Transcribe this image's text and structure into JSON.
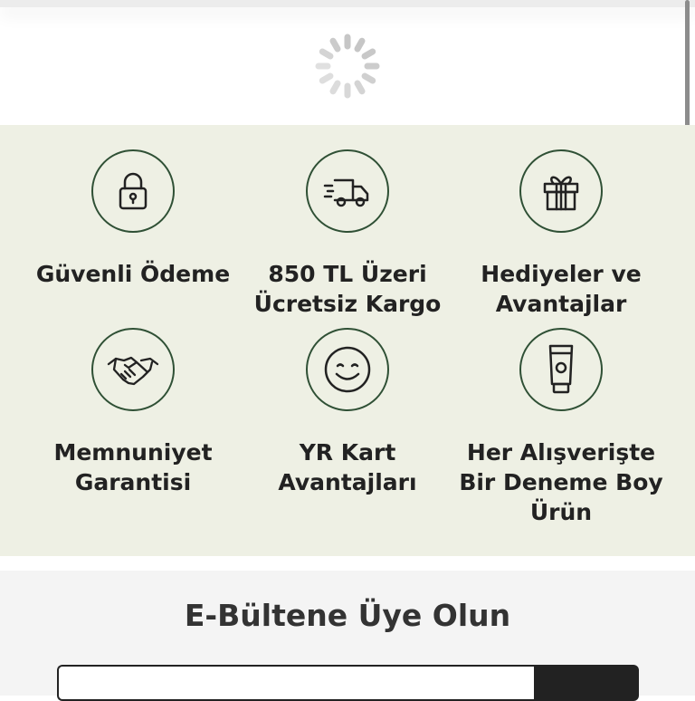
{
  "loading": {
    "icon": "spinner-icon"
  },
  "features": [
    {
      "label": "Güvenli Ödeme",
      "icon": "lock-icon"
    },
    {
      "label": "850 TL Üzeri Ücretsiz Kargo",
      "icon": "delivery-truck-icon"
    },
    {
      "label": "Hediyeler ve Avantajlar",
      "icon": "gift-icon"
    },
    {
      "label": "Memnuniyet Garantisi",
      "icon": "handshake-icon"
    },
    {
      "label": "YR Kart Avantajları",
      "icon": "smiley-icon"
    },
    {
      "label": "Her Alışverişte Bir Deneme Boy Ürün",
      "icon": "tube-icon"
    }
  ],
  "newsletter": {
    "title": "E-Bültene Üye Olun",
    "email_value": "",
    "button_label": ""
  },
  "colors": {
    "features_bg": "#eef0e4",
    "icon_stroke": "#2f5035",
    "newsletter_bg": "#f4f4f4"
  }
}
